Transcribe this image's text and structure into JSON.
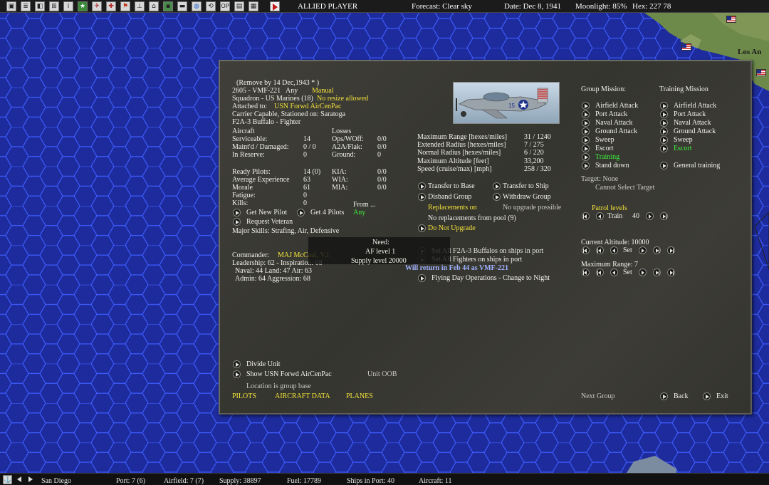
{
  "topbar": {
    "player": "ALLIED PLAYER",
    "forecast": "Forecast: Clear sky",
    "date": "Date: Dec 8, 1941",
    "moonlight": "Moonlight: 85%",
    "hex": "Hex: 227 78",
    "toolbar_icons": [
      "map-select-icon",
      "report-icon",
      "task-force-icon",
      "base-icon",
      "info-icon",
      "ground-icon",
      "air-icon",
      "air-unit-icon",
      "flag-icon",
      "sub-icon",
      "ship-icon",
      "bases-icon",
      "list-icon",
      "globe-icon",
      "recycle-icon",
      "op-icon",
      "intel-icon",
      "settings-icon",
      "end-turn-icon"
    ],
    "op_label": "OP"
  },
  "map": {
    "label_los_angeles": "Los An"
  },
  "unit": {
    "remove_by": "(Remove by 14 Dec,1943 * )",
    "id_name": "2605 - VMF-221",
    "any": "Any",
    "manual": "Manual",
    "squadron": "Squadron - US Marines (18)",
    "no_resize": "No resize allowed",
    "attached_label": "Attached to:",
    "attached_value": "USN Forwd AirCenPac",
    "carrier": "Carrier Capable, Stationed on: Saratoga",
    "aircraft_type": "F2A-3 Buffalo - Fighter"
  },
  "aircraft": {
    "header": "Aircraft",
    "rows": [
      {
        "label": "Serviceable:",
        "value": "14"
      },
      {
        "label": "Maint'd / Damaged:",
        "value": "0 / 0"
      },
      {
        "label": "In Reserve:",
        "value": "0"
      }
    ]
  },
  "losses": {
    "header": "Losses",
    "rows": [
      {
        "label": "Ops/WOff:",
        "value": "0/0"
      },
      {
        "label": "A2A/Flak:",
        "value": "0/0"
      },
      {
        "label": "Ground:",
        "value": "0"
      }
    ]
  },
  "pilots": {
    "rows": [
      {
        "label": "Ready Pilots:",
        "value": "14 (0)"
      },
      {
        "label": "Average Experience",
        "value": "63"
      },
      {
        "label": "Morale",
        "value": "61"
      },
      {
        "label": "Fatigue:",
        "value": "0"
      },
      {
        "label": "Kills:",
        "value": "0"
      }
    ],
    "casualties": [
      {
        "label": "KIA:",
        "value": "0/0"
      },
      {
        "label": "WIA:",
        "value": "0/0"
      },
      {
        "label": "MIA:",
        "value": "0/0"
      }
    ],
    "from_label": "From ...",
    "from_value": "Any",
    "get_new_pilot": "Get New Pilot",
    "get_4_pilots": "Get 4 Pilots",
    "request_veteran": "Request Veteran",
    "major_skills": "Major Skills: Strafing, Air, Defensive"
  },
  "stats": {
    "rows": [
      {
        "label": "Maximum Range [hexes/miles]",
        "value": "31 / 1240"
      },
      {
        "label": "Extended Radius [hexes/miles]",
        "value": "7 / 275"
      },
      {
        "label": "Normal Radius [hexes/miles]",
        "value": "6 / 220"
      },
      {
        "label": "Maximum Altitude [feet]",
        "value": "33,200"
      },
      {
        "label": "Speed (cruise/max) [mph]",
        "value": "258 / 320"
      }
    ]
  },
  "actions": {
    "transfer_base": "Transfer to Base",
    "transfer_ship": "Transfer to Ship",
    "disband": "Disband Group",
    "withdraw": "Withdraw Group",
    "replacements_on": "Replacements on",
    "no_upgrade": "No upgrade possible",
    "no_replacements": "No replacements from pool (9)",
    "do_not_upgrade": "Do Not Upgrade",
    "set_all_f2a": "Set All F2A-3 Buffalos on ships in port",
    "set_all_fighters": "Set All Fighters on ships in port",
    "will_return": "Will return in Feb 44 as VMF-221",
    "flying_day": "Flying Day Operations - Change to Night"
  },
  "need": {
    "title": "Need:",
    "af_level": "AF level 1",
    "supply_level": "Supply level 20000"
  },
  "commander": {
    "label": "Commander:",
    "name": "MAJ McCaul, V.J.",
    "leadership": "Leadership: 62 - Inspiration: 68",
    "naval_land_air": "Naval: 44  Land: 47  Air: 63",
    "admin": "Admin: 64  Aggression: 68"
  },
  "missions": {
    "group_header": "Group Mission:",
    "training_header": "Training Mission",
    "group": [
      "Airfield Attack",
      "Port Attack",
      "Naval Attack",
      "Ground Attack",
      "Sweep",
      "Escort",
      "Training",
      "Stand down"
    ],
    "group_selected": "Training",
    "training": [
      "Airfield Attack",
      "Port Attack",
      "Naval Attack",
      "Ground Attack",
      "Sweep",
      "Escort",
      "General training"
    ],
    "training_selected": "Escort",
    "target": "Target: None",
    "cannot_select": "Cannot Select Target",
    "patrol_levels": "Patrol levels",
    "train_label": "Train",
    "train_value": "40",
    "current_altitude": "Current Altitude: 10000",
    "set_label": "Set",
    "maximum_range": "Maximum Range: 7"
  },
  "bottom_links": {
    "divide": "Divide Unit",
    "show": "Show USN Forwd AirCenPac",
    "unit_oob": "Unit OOB",
    "location": "Location is group base",
    "tabs": [
      "PILOTS",
      "AIRCRAFT DATA",
      "PLANES"
    ],
    "next_group": "Next Group",
    "back": "Back",
    "exit": "Exit"
  },
  "statusbar": {
    "location": "San Diego",
    "port": "Port: 7 (6)",
    "airfield": "Airfield: 7 (7)",
    "supply": "Supply: 38897",
    "fuel": "Fuel: 17789",
    "ships": "Ships in Port: 40",
    "aircraft": "Aircraft: 11"
  },
  "plane_image": {
    "tail_number": "15"
  },
  "colors": {
    "map_sea": "#1f2fa0",
    "hex_line": "#3a54e8",
    "highlight_yellow": "#f2e23a",
    "highlight_green": "#3cf03c",
    "panel_bg": "#3a3a34"
  }
}
